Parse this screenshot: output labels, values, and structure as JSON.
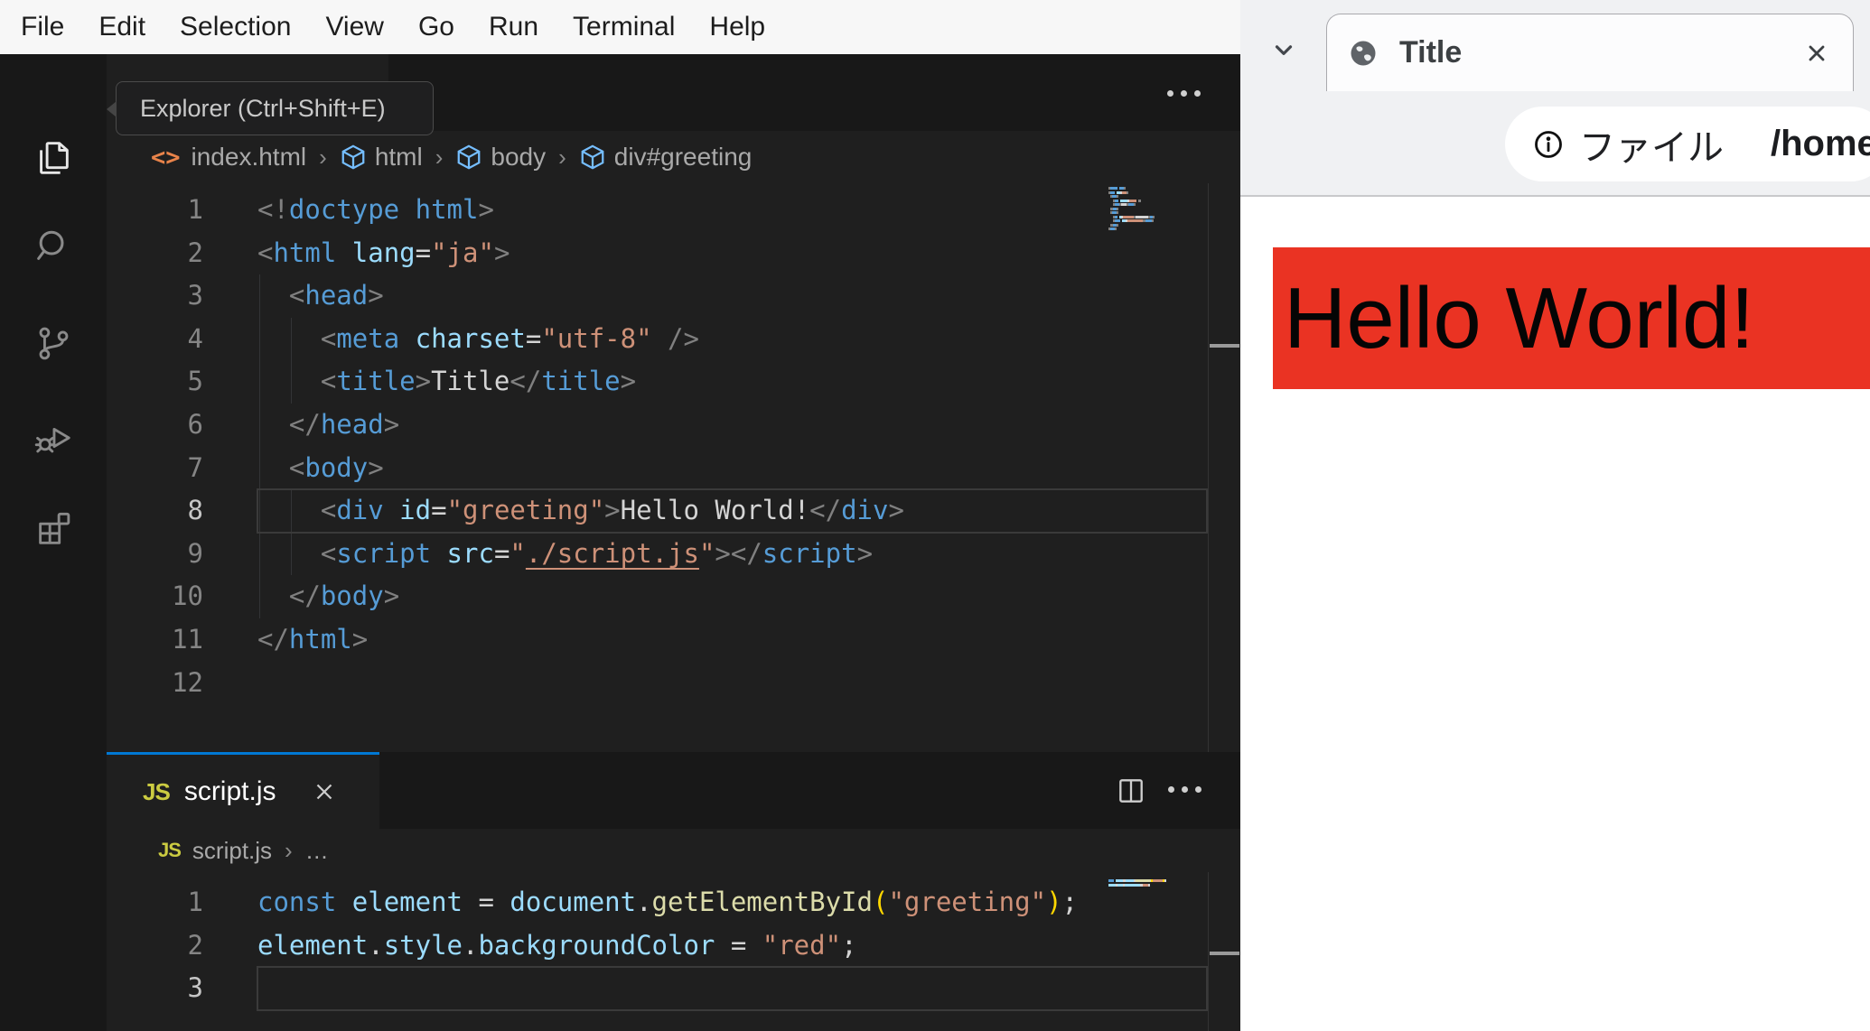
{
  "colors": {
    "tag": "#569cd6",
    "attr": "#9cdcfe",
    "str": "#ce9178",
    "p": "#808080",
    "pl": "#d4d4d4",
    "txt": "#d4d4d4",
    "kw": "#569cd6",
    "vr": "#9cdcfe",
    "fn": "#dcdcaa",
    "par": "#ffd700",
    "lnk": "#ce9178",
    "accent": "#0078d4",
    "red_block": "#ea3323",
    "js_icon": "#cbcb41",
    "cube": "#75beff",
    "html_file_icon": "#e8834a"
  },
  "vscode": {
    "menu": {
      "items": [
        "File",
        "Edit",
        "Selection",
        "View",
        "Go",
        "Run",
        "Terminal",
        "Help"
      ]
    },
    "tooltip": "Explorer (Ctrl+Shift+E)",
    "breadcrumb": {
      "file_icon": "<>",
      "file": "index.html",
      "sep": "›",
      "items": [
        "html",
        "body",
        "div#greeting"
      ]
    },
    "html_editor": {
      "current_line": 8,
      "lines": [
        [
          [
            "p",
            "<!"
          ],
          [
            "tag",
            "doctype"
          ],
          [
            "pl",
            " "
          ],
          [
            "tag",
            "html"
          ],
          [
            "p",
            ">"
          ]
        ],
        [
          [
            "p",
            "<"
          ],
          [
            "tag",
            "html"
          ],
          [
            "pl",
            " "
          ],
          [
            "attr",
            "lang"
          ],
          [
            "pl",
            "="
          ],
          [
            "str",
            "\"ja\""
          ],
          [
            "p",
            ">"
          ]
        ],
        [
          [
            "pl",
            "  "
          ],
          [
            "p",
            "<"
          ],
          [
            "tag",
            "head"
          ],
          [
            "p",
            ">"
          ]
        ],
        [
          [
            "pl",
            "    "
          ],
          [
            "p",
            "<"
          ],
          [
            "tag",
            "meta"
          ],
          [
            "pl",
            " "
          ],
          [
            "attr",
            "charset"
          ],
          [
            "pl",
            "="
          ],
          [
            "str",
            "\"utf-8\""
          ],
          [
            "pl",
            " "
          ],
          [
            "p",
            "/>"
          ]
        ],
        [
          [
            "pl",
            "    "
          ],
          [
            "p",
            "<"
          ],
          [
            "tag",
            "title"
          ],
          [
            "p",
            ">"
          ],
          [
            "txt",
            "Title"
          ],
          [
            "p",
            "</"
          ],
          [
            "tag",
            "title"
          ],
          [
            "p",
            ">"
          ]
        ],
        [
          [
            "pl",
            "  "
          ],
          [
            "p",
            "</"
          ],
          [
            "tag",
            "head"
          ],
          [
            "p",
            ">"
          ]
        ],
        [
          [
            "pl",
            "  "
          ],
          [
            "p",
            "<"
          ],
          [
            "tag",
            "body"
          ],
          [
            "p",
            ">"
          ]
        ],
        [
          [
            "pl",
            "    "
          ],
          [
            "p",
            "<"
          ],
          [
            "tag",
            "div"
          ],
          [
            "pl",
            " "
          ],
          [
            "attr",
            "id"
          ],
          [
            "pl",
            "="
          ],
          [
            "str",
            "\"greeting\""
          ],
          [
            "p",
            ">"
          ],
          [
            "txt",
            "Hello World!"
          ],
          [
            "p",
            "</"
          ],
          [
            "tag",
            "div"
          ],
          [
            "p",
            ">"
          ]
        ],
        [
          [
            "pl",
            "    "
          ],
          [
            "p",
            "<"
          ],
          [
            "tag",
            "script"
          ],
          [
            "pl",
            " "
          ],
          [
            "attr",
            "src"
          ],
          [
            "pl",
            "="
          ],
          [
            "str",
            "\""
          ],
          [
            "lnk",
            "./script.js"
          ],
          [
            "str",
            "\""
          ],
          [
            "p",
            "></"
          ],
          [
            "tag",
            "script"
          ],
          [
            "p",
            ">"
          ]
        ],
        [
          [
            "pl",
            "  "
          ],
          [
            "p",
            "</"
          ],
          [
            "tag",
            "body"
          ],
          [
            "p",
            ">"
          ]
        ],
        [
          [
            "p",
            "</"
          ],
          [
            "tag",
            "html"
          ],
          [
            "p",
            ">"
          ]
        ],
        []
      ]
    },
    "js_editor": {
      "tab_label": "script.js",
      "js_icon": "JS",
      "breadcrumb": {
        "file": "script.js",
        "sep": "›",
        "more": "…"
      },
      "current_line": 3,
      "lines": [
        [
          [
            "kw",
            "const"
          ],
          [
            "pl",
            " "
          ],
          [
            "vr",
            "element"
          ],
          [
            "pl",
            " = "
          ],
          [
            "vr",
            "document"
          ],
          [
            "pl",
            "."
          ],
          [
            "fn",
            "getElementById"
          ],
          [
            "par",
            "("
          ],
          [
            "str",
            "\"greeting\""
          ],
          [
            "par",
            ")"
          ],
          [
            "pl",
            ";"
          ]
        ],
        [
          [
            "vr",
            "element"
          ],
          [
            "pl",
            "."
          ],
          [
            "vr",
            "style"
          ],
          [
            "pl",
            "."
          ],
          [
            "vr",
            "backgroundColor"
          ],
          [
            "pl",
            " = "
          ],
          [
            "str",
            "\"red\""
          ],
          [
            "pl",
            ";"
          ]
        ],
        []
      ]
    }
  },
  "browser": {
    "tab_title": "Title",
    "url_chip": "ファイル",
    "url": "/home/u",
    "page_heading": "Hello World!"
  }
}
